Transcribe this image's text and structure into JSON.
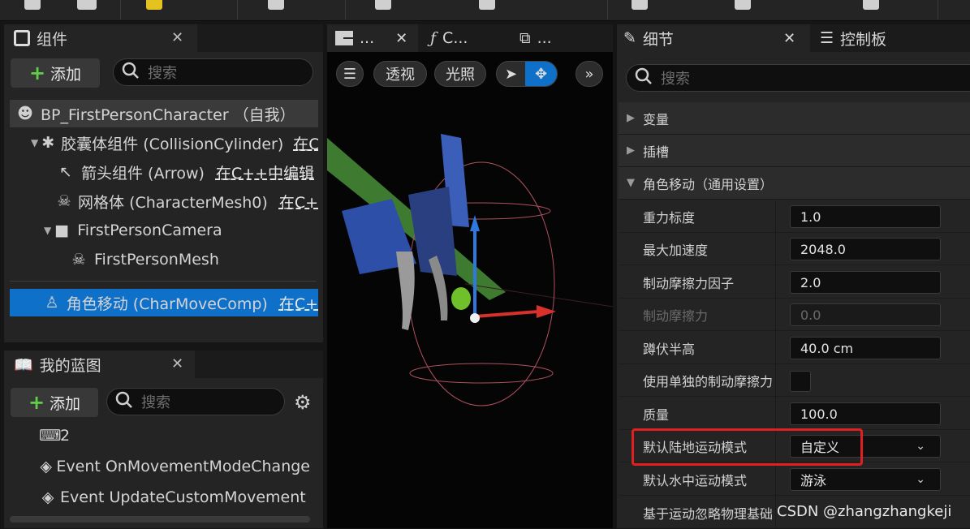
{
  "components_panel": {
    "title": "组件",
    "add_label": "添加",
    "search_placeholder": "搜索",
    "tree": [
      {
        "label": "BP_FirstPersonCharacter （自我）",
        "link": ""
      },
      {
        "label": "胶囊体组件 (CollisionCylinder)",
        "link": "在C"
      },
      {
        "label": "箭头组件 (Arrow)",
        "link": "在C++中编辑"
      },
      {
        "label": "网格体 (CharacterMesh0)",
        "link": "在C+"
      },
      {
        "label": "FirstPersonCamera",
        "link": ""
      },
      {
        "label": "FirstPersonMesh",
        "link": ""
      },
      {
        "label": "角色移动 (CharMoveComp)",
        "link": "在C+"
      }
    ]
  },
  "blueprint_panel": {
    "title": "我的蓝图",
    "add_label": "添加",
    "search_placeholder": "搜索",
    "items": [
      {
        "label": "2"
      },
      {
        "label": "Event OnMovementModeChange"
      },
      {
        "label": "Event UpdateCustomMovement"
      }
    ]
  },
  "viewport": {
    "tabs": [
      {
        "label": "...",
        "icon": "viewport-icon"
      },
      {
        "label": "C...",
        "icon": "function-icon"
      },
      {
        "label": "...",
        "icon": "graph-icon"
      }
    ],
    "perspective_label": "透视",
    "lighting_label": "光照"
  },
  "details_panel": {
    "title": "细节",
    "other_tab": "控制板",
    "search_placeholder": "搜索",
    "categories": [
      "变量",
      "插槽",
      "角色移动（通用设置）"
    ],
    "properties": [
      {
        "label": "重力标度",
        "value": "1.0",
        "type": "text",
        "enabled": true
      },
      {
        "label": "最大加速度",
        "value": "2048.0",
        "type": "text",
        "enabled": true
      },
      {
        "label": "制动摩擦力因子",
        "value": "2.0",
        "type": "text",
        "enabled": true
      },
      {
        "label": "制动摩擦力",
        "value": "0.0",
        "type": "text",
        "enabled": false
      },
      {
        "label": "蹲伏半高",
        "value": "40.0 cm",
        "type": "text",
        "enabled": true
      },
      {
        "label": "使用单独的制动摩擦力",
        "value": "",
        "type": "checkbox",
        "enabled": true
      },
      {
        "label": "质量",
        "value": "100.0",
        "type": "text",
        "enabled": true
      },
      {
        "label": "默认陆地运动模式",
        "value": "自定义",
        "type": "dropdown",
        "enabled": true
      },
      {
        "label": "默认水中运动模式",
        "value": "游泳",
        "type": "dropdown",
        "enabled": true
      },
      {
        "label": "基于运动忽略物理基础",
        "value": "",
        "type": "checkbox",
        "enabled": true
      }
    ]
  },
  "watermark": "CSDN @zhangzhangkeji",
  "colors": {
    "selection": "#0e70c9",
    "highlight_box": "#e02020",
    "add_plus": "#5fcf4a"
  }
}
